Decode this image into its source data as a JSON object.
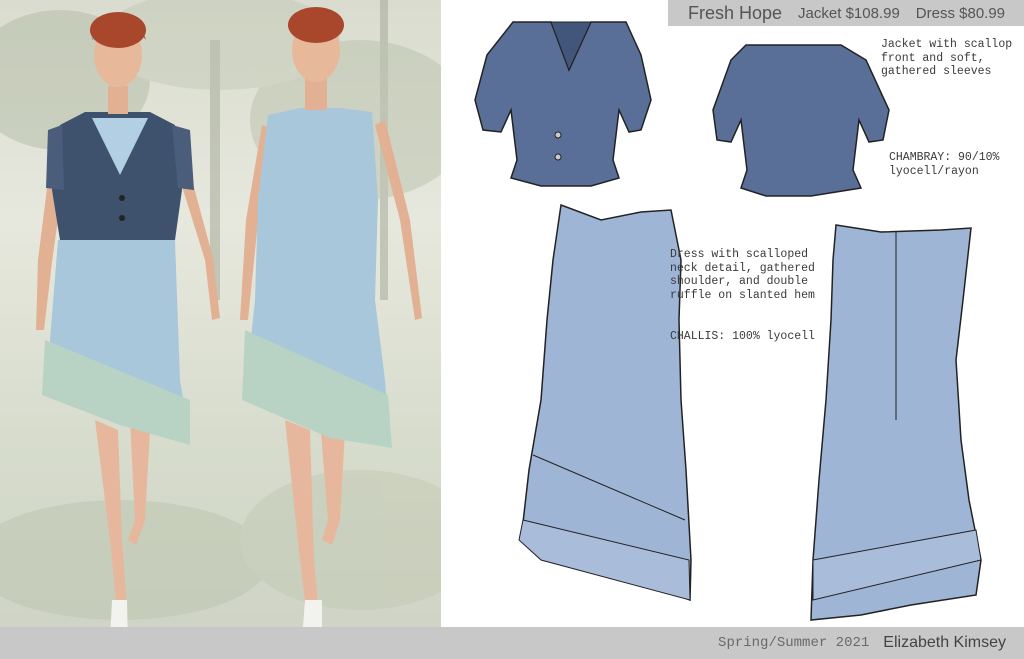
{
  "header": {
    "title": "Fresh Hope",
    "jacket_price": "Jacket $108.99",
    "dress_price": "Dress $80.99"
  },
  "notes": {
    "jacket_desc": "Jacket with scallop\nfront and soft,\ngathered sleeves",
    "jacket_fabric": "CHAMBRAY:  90/10%\nlyocell/rayon",
    "dress_desc": "Dress with scalloped\nneck detail, gathered\nshoulder, and double\nruffle on slanted hem",
    "dress_fabric": "CHALLIS:  100% lyocell"
  },
  "footer": {
    "season": "Spring/Summer 2021",
    "designer": "Elizabeth Kimsey"
  },
  "colors": {
    "chambray": "#5a6f98",
    "challis": "#9fb5d6",
    "bar_gray": "#c8c8c8"
  }
}
